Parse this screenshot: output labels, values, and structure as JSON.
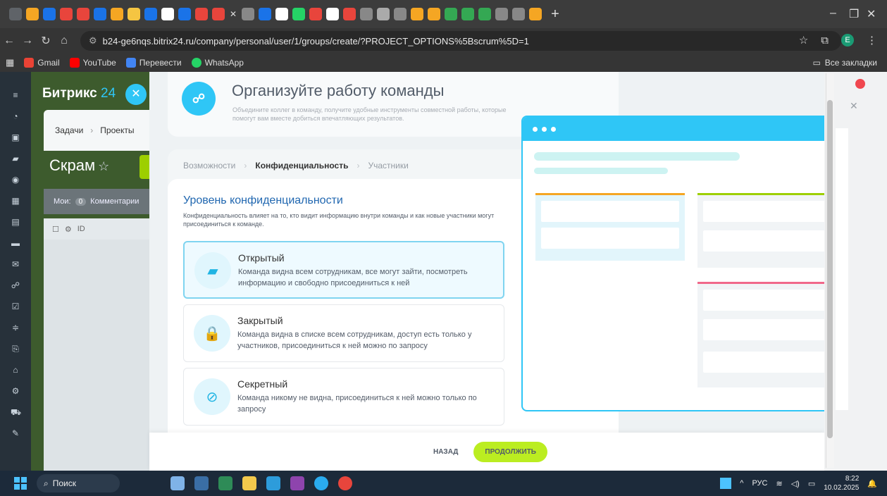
{
  "browser": {
    "url": "b24-ge6nqs.bitrix24.ru/company/personal/user/1/groups/create/?PROJECT_OPTIONS%5Bscrum%5D=1",
    "bookmarks": [
      "Gmail",
      "YouTube",
      "Перевести",
      "WhatsApp"
    ],
    "all_bookmarks": "Все закладки",
    "tab_colors": [
      "#5f6368",
      "#f5a623",
      "#1a73e8",
      "#e8453c",
      "#e8453c",
      "#1a73e8",
      "#f5a623",
      "#f5c542",
      "#1a73e8",
      "#ffffff",
      "#1a73e8",
      "#e8453c",
      "#e8453c",
      "#888888",
      "#1a73e8",
      "#ffffff",
      "#25d366",
      "#e8453c",
      "#ffffff",
      "#e8453c",
      "#888888",
      "#aaaaaa",
      "#888888",
      "#f5a623",
      "#f5a623",
      "#34a853",
      "#34a853",
      "#34a853",
      "#888888",
      "#888888",
      "#f5a623"
    ]
  },
  "b24": {
    "logo": "Битрикс",
    "logo_num": "24",
    "tabs": [
      "Задачи",
      "Проекты"
    ],
    "scrum_title": "Скрам",
    "filter_label": "Мои:",
    "filter_count": "0",
    "filter_text": "Комментарии",
    "grid_id": "ID"
  },
  "promo": {
    "title": "Организуйте работу команды",
    "desc": "Объедините коллег в команду, получите удобные инструменты совместной работы, которые помогут вам вместе добиться впечатляющих результатов."
  },
  "wizard": {
    "steps": [
      "Возможности",
      "Конфиденциальность",
      "Участники"
    ],
    "title": "Уровень конфиденциальности",
    "desc": "Конфиденциальность влияет на то, кто видит информацию внутри команды и как новые участники могут присоединиться к команде.",
    "options": [
      {
        "title": "Открытый",
        "desc": "Команда видна всем сотрудникам, все могут зайти, посмотреть информацию и свободно присоединиться к ней",
        "icon": "folder-icon"
      },
      {
        "title": "Закрытый",
        "desc": "Команда видна в списке всем сотрудникам, доступ есть только у участников, присоединиться к ней можно по запросу",
        "icon": "lock-icon"
      },
      {
        "title": "Секретный",
        "desc": "Команда никому не видна, присоединиться к ней можно только по запросу",
        "icon": "hidden-folder-icon"
      }
    ],
    "back": "НАЗАД",
    "next": "ПРОДОЛЖИТЬ"
  },
  "taskbar": {
    "search": "Поиск",
    "lang": "РУС",
    "time": "8:22",
    "date": "10.02.2025"
  },
  "colors": {
    "accent": "#2fc6f6",
    "next_button": "#bbed21",
    "link_blue": "#2067b0"
  }
}
